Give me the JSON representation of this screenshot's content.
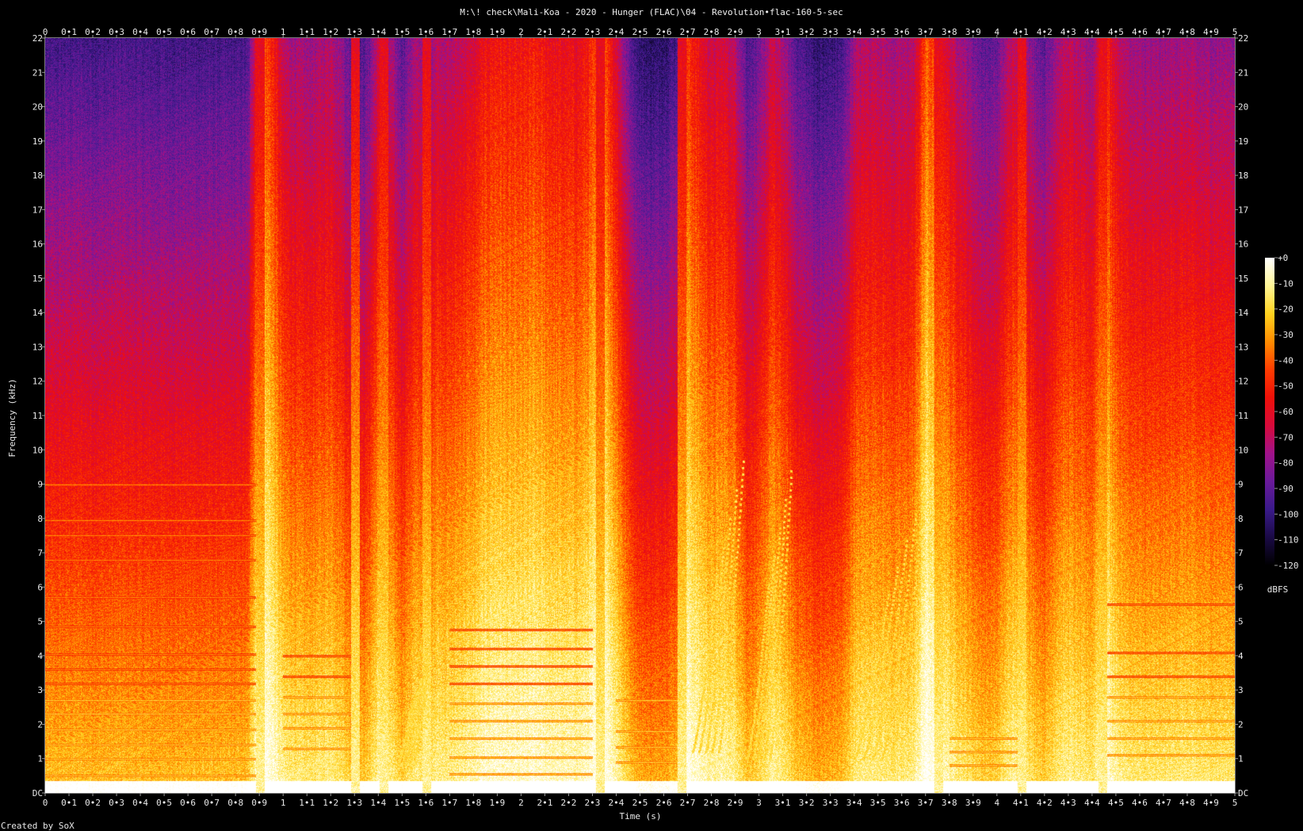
{
  "chart_data": {
    "type": "heatmap",
    "title": "M:\\! check\\Mali-Koa - 2020 - Hunger (FLAC)\\04 - Revolution•flac-160-5-sec",
    "xlabel": "Time (s)",
    "ylabel": "Frequency (kHz)",
    "footer": "Created by SoX",
    "xlim": [
      0,
      5
    ],
    "ylim": [
      0,
      22
    ],
    "x_ticks": [
      "0",
      "0•1",
      "0•2",
      "0•3",
      "0•4",
      "0•5",
      "0•6",
      "0•7",
      "0•8",
      "0•9",
      "1",
      "1•1",
      "1•2",
      "1•3",
      "1•4",
      "1•5",
      "1•6",
      "1•7",
      "1•8",
      "1•9",
      "2",
      "2•1",
      "2•2",
      "2•3",
      "2•4",
      "2•5",
      "2•6",
      "2•7",
      "2•8",
      "2•9",
      "3",
      "3•1",
      "3•2",
      "3•3",
      "3•4",
      "3•5",
      "3•6",
      "3•7",
      "3•8",
      "3•9",
      "4",
      "4•1",
      "4•2",
      "4•3",
      "4•4",
      "4•5",
      "4•6",
      "4•7",
      "4•8",
      "4•9",
      "5"
    ],
    "y_ticks": [
      "DC",
      "1",
      "2",
      "3",
      "4",
      "5",
      "6",
      "7",
      "8",
      "9",
      "10",
      "11",
      "12",
      "13",
      "14",
      "15",
      "16",
      "17",
      "18",
      "19",
      "20",
      "21",
      "22"
    ],
    "colorbar": {
      "unit": "dBFS",
      "range": [
        -120,
        0
      ],
      "ticks": [
        "+0",
        "-10",
        "-20",
        "-30",
        "-40",
        "-50",
        "-60",
        "-70",
        "-80",
        "-90",
        "-100",
        "-110",
        "-120"
      ],
      "stops": [
        "#000000",
        "#1a0a46",
        "#3a1a8a",
        "#6a1a9a",
        "#a0128a",
        "#d80a3a",
        "#f01008",
        "#ff3c00",
        "#ff8c00",
        "#ffd21e",
        "#fff596",
        "#ffffff"
      ]
    },
    "energy_profile": {
      "description": "per-time relative energy (0-1) sampled every 0.05 s",
      "t": [
        0,
        0.05,
        0.1,
        0.15,
        0.2,
        0.25,
        0.3,
        0.35,
        0.4,
        0.45,
        0.5,
        0.55,
        0.6,
        0.65,
        0.7,
        0.75,
        0.8,
        0.85,
        0.9,
        0.95,
        1.0,
        1.05,
        1.1,
        1.15,
        1.2,
        1.25,
        1.3,
        1.35,
        1.4,
        1.45,
        1.5,
        1.55,
        1.6,
        1.65,
        1.7,
        1.75,
        1.8,
        1.85,
        1.9,
        1.95,
        2.0,
        2.05,
        2.1,
        2.15,
        2.2,
        2.25,
        2.3,
        2.35,
        2.4,
        2.45,
        2.5,
        2.55,
        2.6,
        2.65,
        2.7,
        2.75,
        2.8,
        2.85,
        2.9,
        2.95,
        3.0,
        3.05,
        3.1,
        3.15,
        3.2,
        3.25,
        3.3,
        3.35,
        3.4,
        3.45,
        3.5,
        3.55,
        3.6,
        3.65,
        3.7,
        3.75,
        3.8,
        3.85,
        3.9,
        3.95,
        4.0,
        4.05,
        4.1,
        4.15,
        4.2,
        4.25,
        4.3,
        4.35,
        4.4,
        4.45,
        4.5,
        4.55,
        4.6,
        4.65,
        4.7,
        4.75,
        4.8,
        4.85,
        4.9,
        4.95,
        5.0
      ],
      "e": [
        0.55,
        0.55,
        0.56,
        0.56,
        0.55,
        0.55,
        0.56,
        0.56,
        0.55,
        0.55,
        0.55,
        0.55,
        0.55,
        0.55,
        0.55,
        0.55,
        0.55,
        0.56,
        0.98,
        0.9,
        0.75,
        0.72,
        0.7,
        0.72,
        0.75,
        0.68,
        0.55,
        0.6,
        0.78,
        0.72,
        0.6,
        0.72,
        0.7,
        0.76,
        0.74,
        0.78,
        0.8,
        0.86,
        0.88,
        0.86,
        0.86,
        0.88,
        0.86,
        0.84,
        0.84,
        0.84,
        0.9,
        0.95,
        0.8,
        0.62,
        0.5,
        0.48,
        0.5,
        0.55,
        0.92,
        0.84,
        0.78,
        0.8,
        0.75,
        0.58,
        0.62,
        0.78,
        0.72,
        0.6,
        0.55,
        0.5,
        0.52,
        0.55,
        0.72,
        0.75,
        0.75,
        0.72,
        0.72,
        0.75,
        0.96,
        0.9,
        0.78,
        0.72,
        0.65,
        0.6,
        0.62,
        0.75,
        0.78,
        0.66,
        0.6,
        0.72,
        0.76,
        0.72,
        0.7,
        0.92,
        0.78,
        0.72,
        0.7,
        0.7,
        0.7,
        0.72,
        0.72,
        0.7,
        0.7,
        0.7,
        0.7
      ]
    },
    "transients_s": [
      0.9,
      1.3,
      1.42,
      1.6,
      2.33,
      2.67,
      3.75,
      4.1,
      4.44
    ],
    "harmonic_segments": [
      {
        "t": [
          0.0,
          0.9
        ],
        "f0_khz": 0.5,
        "harmonics_khz": [
          0.5,
          1.0,
          1.4,
          1.85,
          2.3,
          2.7,
          3.2,
          3.6,
          4.05,
          4.85,
          5.7,
          6.8,
          7.5,
          7.95,
          9.0
        ]
      },
      {
        "t": [
          1.0,
          1.3
        ],
        "f0_khz": 0.6,
        "harmonics_khz": [
          1.3,
          1.9,
          2.3,
          2.8,
          3.4,
          4.0
        ]
      },
      {
        "t": [
          1.7,
          2.3
        ],
        "f0_khz": 0.55,
        "harmonics_khz": [
          0.55,
          1.05,
          1.6,
          2.1,
          2.6,
          3.2,
          3.7,
          4.2,
          4.75
        ]
      },
      {
        "t": [
          2.4,
          2.65
        ],
        "f0_khz": 0.45,
        "harmonics_khz": [
          0.9,
          1.35,
          1.8,
          2.7
        ]
      },
      {
        "t": [
          3.8,
          4.1
        ],
        "f0_khz": 0.4,
        "harmonics_khz": [
          0.8,
          1.2,
          1.6
        ]
      },
      {
        "t": [
          4.45,
          5.0
        ],
        "f0_khz": 0.55,
        "harmonics_khz": [
          1.1,
          1.6,
          2.1,
          2.8,
          3.4,
          4.1,
          5.5
        ]
      }
    ],
    "glide_segments": [
      {
        "t": [
          1.48,
          1.62
        ],
        "f_start_khz": 0.8,
        "f_end_khz": 4.2
      },
      {
        "t": [
          2.72,
          2.95
        ],
        "f_start_khz": 1.2,
        "f_end_khz": 10.5
      },
      {
        "t": [
          2.95,
          3.15
        ],
        "f_start_khz": 1.0,
        "f_end_khz": 10.2
      },
      {
        "t": [
          3.4,
          3.72
        ],
        "f_start_khz": 1.0,
        "f_end_khz": 9.7
      }
    ]
  }
}
